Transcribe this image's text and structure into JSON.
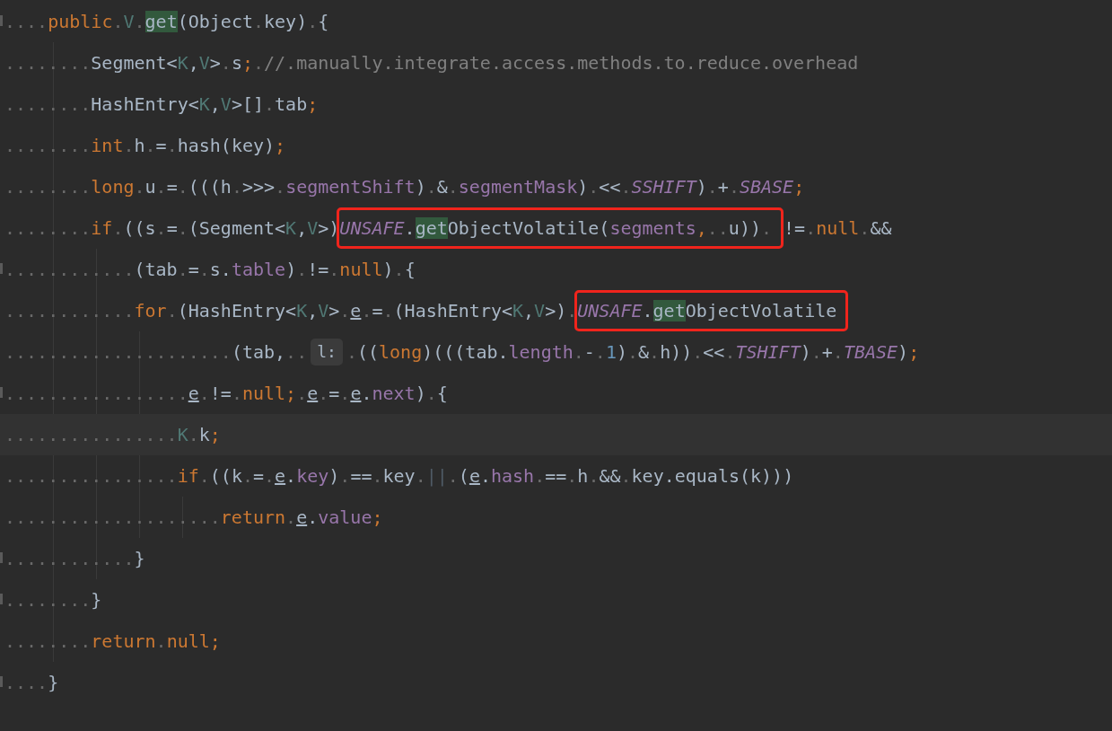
{
  "editor": {
    "lines": [
      {
        "fold": true,
        "segments": [
          {
            "kind": "code",
            "tokens": [
              {
                "text": "....",
                "kind": "ws"
              },
              {
                "text": "public",
                "kind": "kw"
              },
              {
                "text": ".",
                "kind": "ws"
              },
              {
                "text": "V",
                "kind": "tp"
              },
              {
                "text": ".",
                "kind": "ws"
              },
              {
                "text": "get",
                "kind": "hl"
              },
              {
                "text": "(Object",
                "kind": "p"
              },
              {
                "text": ".",
                "kind": "ws"
              },
              {
                "text": "key)",
                "kind": "p"
              },
              {
                "text": ".",
                "kind": "ws"
              },
              {
                "text": "{",
                "kind": "p"
              }
            ]
          }
        ]
      },
      {
        "segments": [
          {
            "kind": "code",
            "tokens": [
              {
                "text": "........",
                "kind": "ws"
              },
              {
                "text": "Segment<",
                "kind": "p"
              },
              {
                "text": "K",
                "kind": "tp"
              },
              {
                "text": ",",
                "kind": "p"
              },
              {
                "text": "V",
                "kind": "tp"
              },
              {
                "text": ">",
                "kind": "p"
              },
              {
                "text": ".",
                "kind": "ws"
              },
              {
                "text": "s",
                "kind": "p"
              },
              {
                "text": ";",
                "kind": "kw"
              },
              {
                "text": ".",
                "kind": "ws"
              },
              {
                "text": "//.manually.integrate.access.methods.to.reduce.overhead",
                "kind": "c"
              }
            ]
          }
        ]
      },
      {
        "segments": [
          {
            "kind": "code",
            "tokens": [
              {
                "text": "........",
                "kind": "ws"
              },
              {
                "text": "HashEntry<",
                "kind": "p"
              },
              {
                "text": "K",
                "kind": "tp"
              },
              {
                "text": ",",
                "kind": "p"
              },
              {
                "text": "V",
                "kind": "tp"
              },
              {
                "text": ">[]",
                "kind": "p"
              },
              {
                "text": ".",
                "kind": "ws"
              },
              {
                "text": "tab",
                "kind": "p"
              },
              {
                "text": ";",
                "kind": "kw"
              }
            ]
          }
        ]
      },
      {
        "segments": [
          {
            "kind": "code",
            "tokens": [
              {
                "text": "........",
                "kind": "ws"
              },
              {
                "text": "int",
                "kind": "kw"
              },
              {
                "text": ".",
                "kind": "ws"
              },
              {
                "text": "h",
                "kind": "p"
              },
              {
                "text": ".",
                "kind": "ws"
              },
              {
                "text": "=",
                "kind": "p"
              },
              {
                "text": ".",
                "kind": "ws"
              },
              {
                "text": "hash(key)",
                "kind": "p"
              },
              {
                "text": ";",
                "kind": "kw"
              }
            ]
          }
        ]
      },
      {
        "segments": [
          {
            "kind": "code",
            "tokens": [
              {
                "text": "........",
                "kind": "ws"
              },
              {
                "text": "long",
                "kind": "kw"
              },
              {
                "text": ".",
                "kind": "ws"
              },
              {
                "text": "u",
                "kind": "p"
              },
              {
                "text": ".",
                "kind": "ws"
              },
              {
                "text": "=",
                "kind": "p"
              },
              {
                "text": ".",
                "kind": "ws"
              },
              {
                "text": "(((h",
                "kind": "p"
              },
              {
                "text": ".",
                "kind": "ws"
              },
              {
                "text": ">>>",
                "kind": "p"
              },
              {
                "text": ".",
                "kind": "ws"
              },
              {
                "text": "segmentShift",
                "kind": "f"
              },
              {
                "text": ")",
                "kind": "p"
              },
              {
                "text": ".",
                "kind": "ws"
              },
              {
                "text": "&",
                "kind": "p"
              },
              {
                "text": ".",
                "kind": "ws"
              },
              {
                "text": "segmentMask",
                "kind": "f"
              },
              {
                "text": ")",
                "kind": "p"
              },
              {
                "text": ".",
                "kind": "ws"
              },
              {
                "text": "<<",
                "kind": "p"
              },
              {
                "text": ".",
                "kind": "ws"
              },
              {
                "text": "SSHIFT",
                "kind": "st"
              },
              {
                "text": ")",
                "kind": "p"
              },
              {
                "text": ".",
                "kind": "ws"
              },
              {
                "text": "+",
                "kind": "p"
              },
              {
                "text": ".",
                "kind": "ws"
              },
              {
                "text": "SBASE",
                "kind": "st"
              },
              {
                "text": ";",
                "kind": "kw"
              }
            ]
          }
        ]
      },
      {
        "segments": [
          {
            "kind": "code",
            "tokens": [
              {
                "text": "........",
                "kind": "ws"
              },
              {
                "text": "if",
                "kind": "kw"
              },
              {
                "text": ".",
                "kind": "ws"
              },
              {
                "text": "((s",
                "kind": "p"
              },
              {
                "text": ".",
                "kind": "ws"
              },
              {
                "text": "=",
                "kind": "p"
              },
              {
                "text": ".",
                "kind": "ws"
              },
              {
                "text": "(Segment<",
                "kind": "p"
              },
              {
                "text": "K",
                "kind": "tp"
              },
              {
                "text": ",",
                "kind": "p"
              },
              {
                "text": "V",
                "kind": "tp"
              },
              {
                "text": ">)",
                "kind": "p"
              }
            ]
          },
          {
            "kind": "box",
            "tokens": [
              {
                "text": "UNSAFE",
                "kind": "st"
              },
              {
                "text": ".",
                "kind": "p"
              },
              {
                "text": "get",
                "kind": "hl"
              },
              {
                "text": "ObjectVolatile(",
                "kind": "p"
              },
              {
                "text": "segments",
                "kind": "f"
              },
              {
                "text": ",",
                "kind": "kw"
              },
              {
                "text": "..",
                "kind": "ws"
              },
              {
                "text": "u))",
                "kind": "p"
              },
              {
                "text": ".",
                "kind": "ws"
              }
            ]
          },
          {
            "kind": "code",
            "tokens": [
              {
                "text": "!=",
                "kind": "p"
              },
              {
                "text": ".",
                "kind": "ws"
              },
              {
                "text": "null",
                "kind": "kw"
              },
              {
                "text": ".",
                "kind": "ws"
              },
              {
                "text": "&&",
                "kind": "p"
              }
            ]
          }
        ]
      },
      {
        "fold": true,
        "segments": [
          {
            "kind": "code",
            "tokens": [
              {
                "text": "............",
                "kind": "ws"
              },
              {
                "text": "(tab",
                "kind": "p"
              },
              {
                "text": ".",
                "kind": "ws"
              },
              {
                "text": "=",
                "kind": "p"
              },
              {
                "text": ".",
                "kind": "ws"
              },
              {
                "text": "s.",
                "kind": "p"
              },
              {
                "text": "table",
                "kind": "f"
              },
              {
                "text": ")",
                "kind": "p"
              },
              {
                "text": ".",
                "kind": "ws"
              },
              {
                "text": "!=",
                "kind": "p"
              },
              {
                "text": ".",
                "kind": "ws"
              },
              {
                "text": "null",
                "kind": "kw"
              },
              {
                "text": ")",
                "kind": "p"
              },
              {
                "text": ".",
                "kind": "ws"
              },
              {
                "text": "{",
                "kind": "p"
              }
            ]
          }
        ]
      },
      {
        "segments": [
          {
            "kind": "code",
            "tokens": [
              {
                "text": "............",
                "kind": "ws"
              },
              {
                "text": "for",
                "kind": "kw"
              },
              {
                "text": ".",
                "kind": "ws"
              },
              {
                "text": "(HashEntry<",
                "kind": "p"
              },
              {
                "text": "K",
                "kind": "tp"
              },
              {
                "text": ",",
                "kind": "p"
              },
              {
                "text": "V",
                "kind": "tp"
              },
              {
                "text": ">",
                "kind": "p"
              },
              {
                "text": ".",
                "kind": "ws"
              },
              {
                "text": "e",
                "kind": "u"
              },
              {
                "text": ".",
                "kind": "ws"
              },
              {
                "text": "=",
                "kind": "p"
              },
              {
                "text": ".",
                "kind": "ws"
              },
              {
                "text": "(HashEntry<",
                "kind": "p"
              },
              {
                "text": "K",
                "kind": "tp"
              },
              {
                "text": ",",
                "kind": "p"
              },
              {
                "text": "V",
                "kind": "tp"
              },
              {
                "text": ">)",
                "kind": "p"
              },
              {
                "text": ".",
                "kind": "ws"
              }
            ]
          },
          {
            "kind": "box",
            "tokens": [
              {
                "text": "UNSAFE",
                "kind": "st"
              },
              {
                "text": ".",
                "kind": "p"
              },
              {
                "text": "get",
                "kind": "hl"
              },
              {
                "text": "ObjectVolatile",
                "kind": "p"
              }
            ]
          }
        ]
      },
      {
        "segments": [
          {
            "kind": "code",
            "tokens": [
              {
                "text": ".....................",
                "kind": "ws"
              },
              {
                "text": "(tab,",
                "kind": "p"
              },
              {
                "text": "..",
                "kind": "ws"
              }
            ]
          },
          {
            "kind": "hint",
            "tokens": [
              {
                "text": "l:",
                "kind": "p"
              }
            ]
          },
          {
            "kind": "code",
            "tokens": [
              {
                "text": ".",
                "kind": "ws"
              },
              {
                "text": "((",
                "kind": "p"
              },
              {
                "text": "long",
                "kind": "kw"
              },
              {
                "text": ")(((tab.",
                "kind": "p"
              },
              {
                "text": "length",
                "kind": "f"
              },
              {
                "text": ".",
                "kind": "ws"
              },
              {
                "text": "-",
                "kind": "p"
              },
              {
                "text": ".",
                "kind": "ws"
              },
              {
                "text": "1",
                "kind": "n"
              },
              {
                "text": ")",
                "kind": "p"
              },
              {
                "text": ".",
                "kind": "ws"
              },
              {
                "text": "&",
                "kind": "p"
              },
              {
                "text": ".",
                "kind": "ws"
              },
              {
                "text": "h))",
                "kind": "p"
              },
              {
                "text": ".",
                "kind": "ws"
              },
              {
                "text": "<<",
                "kind": "p"
              },
              {
                "text": ".",
                "kind": "ws"
              },
              {
                "text": "TSHIFT",
                "kind": "st"
              },
              {
                "text": ")",
                "kind": "p"
              },
              {
                "text": ".",
                "kind": "ws"
              },
              {
                "text": "+",
                "kind": "p"
              },
              {
                "text": ".",
                "kind": "ws"
              },
              {
                "text": "TBASE",
                "kind": "st"
              },
              {
                "text": ")",
                "kind": "p"
              },
              {
                "text": ";",
                "kind": "kw"
              }
            ]
          }
        ]
      },
      {
        "fold": true,
        "segments": [
          {
            "kind": "code",
            "tokens": [
              {
                "text": ".................",
                "kind": "ws"
              },
              {
                "text": "e",
                "kind": "u"
              },
              {
                "text": ".",
                "kind": "ws"
              },
              {
                "text": "!=",
                "kind": "p"
              },
              {
                "text": ".",
                "kind": "ws"
              },
              {
                "text": "null",
                "kind": "kw"
              },
              {
                "text": ";",
                "kind": "kw"
              },
              {
                "text": ".",
                "kind": "ws"
              },
              {
                "text": "e",
                "kind": "u"
              },
              {
                "text": ".",
                "kind": "ws"
              },
              {
                "text": "=",
                "kind": "p"
              },
              {
                "text": ".",
                "kind": "ws"
              },
              {
                "text": "e",
                "kind": "u"
              },
              {
                "text": ".",
                "kind": "p"
              },
              {
                "text": "next",
                "kind": "f"
              },
              {
                "text": ")",
                "kind": "p"
              },
              {
                "text": ".",
                "kind": "ws"
              },
              {
                "text": "{",
                "kind": "p"
              }
            ]
          }
        ]
      },
      {
        "current": true,
        "segments": [
          {
            "kind": "code",
            "tokens": [
              {
                "text": "................",
                "kind": "ws"
              },
              {
                "text": "K",
                "kind": "tp"
              },
              {
                "text": ".",
                "kind": "ws"
              },
              {
                "text": "k",
                "kind": "p"
              },
              {
                "text": ";",
                "kind": "kw"
              }
            ]
          }
        ]
      },
      {
        "segments": [
          {
            "kind": "code",
            "tokens": [
              {
                "text": "................",
                "kind": "ws"
              },
              {
                "text": "if",
                "kind": "kw"
              },
              {
                "text": ".",
                "kind": "ws"
              },
              {
                "text": "((k",
                "kind": "p"
              },
              {
                "text": ".",
                "kind": "ws"
              },
              {
                "text": "=",
                "kind": "p"
              },
              {
                "text": ".",
                "kind": "ws"
              },
              {
                "text": "e",
                "kind": "u"
              },
              {
                "text": ".",
                "kind": "p"
              },
              {
                "text": "key",
                "kind": "f"
              },
              {
                "text": ")",
                "kind": "p"
              },
              {
                "text": ".",
                "kind": "ws"
              },
              {
                "text": "==",
                "kind": "p"
              },
              {
                "text": ".",
                "kind": "ws"
              },
              {
                "text": "key",
                "kind": "p"
              },
              {
                "text": ".",
                "kind": "ws"
              },
              {
                "text": "||",
                "kind": "dim"
              },
              {
                "text": ".",
                "kind": "ws"
              },
              {
                "text": "(",
                "kind": "p"
              },
              {
                "text": "e",
                "kind": "u"
              },
              {
                "text": ".",
                "kind": "p"
              },
              {
                "text": "hash",
                "kind": "f"
              },
              {
                "text": ".",
                "kind": "ws"
              },
              {
                "text": "==",
                "kind": "p"
              },
              {
                "text": ".",
                "kind": "ws"
              },
              {
                "text": "h",
                "kind": "p"
              },
              {
                "text": ".",
                "kind": "ws"
              },
              {
                "text": "&&",
                "kind": "p"
              },
              {
                "text": ".",
                "kind": "ws"
              },
              {
                "text": "key.equals(k)))",
                "kind": "p"
              }
            ]
          }
        ]
      },
      {
        "segments": [
          {
            "kind": "code",
            "tokens": [
              {
                "text": "....................",
                "kind": "ws"
              },
              {
                "text": "return",
                "kind": "kw"
              },
              {
                "text": ".",
                "kind": "ws"
              },
              {
                "text": "e",
                "kind": "u"
              },
              {
                "text": ".",
                "kind": "p"
              },
              {
                "text": "value",
                "kind": "f"
              },
              {
                "text": ";",
                "kind": "kw"
              }
            ]
          }
        ]
      },
      {
        "fold": true,
        "segments": [
          {
            "kind": "code",
            "tokens": [
              {
                "text": "............",
                "kind": "ws"
              },
              {
                "text": "}",
                "kind": "p"
              }
            ]
          }
        ]
      },
      {
        "fold": true,
        "segments": [
          {
            "kind": "code",
            "tokens": [
              {
                "text": "........",
                "kind": "ws"
              },
              {
                "text": "}",
                "kind": "p"
              }
            ]
          }
        ]
      },
      {
        "segments": [
          {
            "kind": "code",
            "tokens": [
              {
                "text": "........",
                "kind": "ws"
              },
              {
                "text": "return",
                "kind": "kw"
              },
              {
                "text": ".",
                "kind": "ws"
              },
              {
                "text": "null",
                "kind": "kw"
              },
              {
                "text": ";",
                "kind": "kw"
              }
            ]
          }
        ]
      },
      {
        "fold": true,
        "segments": [
          {
            "kind": "code",
            "tokens": [
              {
                "text": "....",
                "kind": "ws"
              },
              {
                "text": "}",
                "kind": "p"
              }
            ]
          }
        ]
      }
    ]
  }
}
